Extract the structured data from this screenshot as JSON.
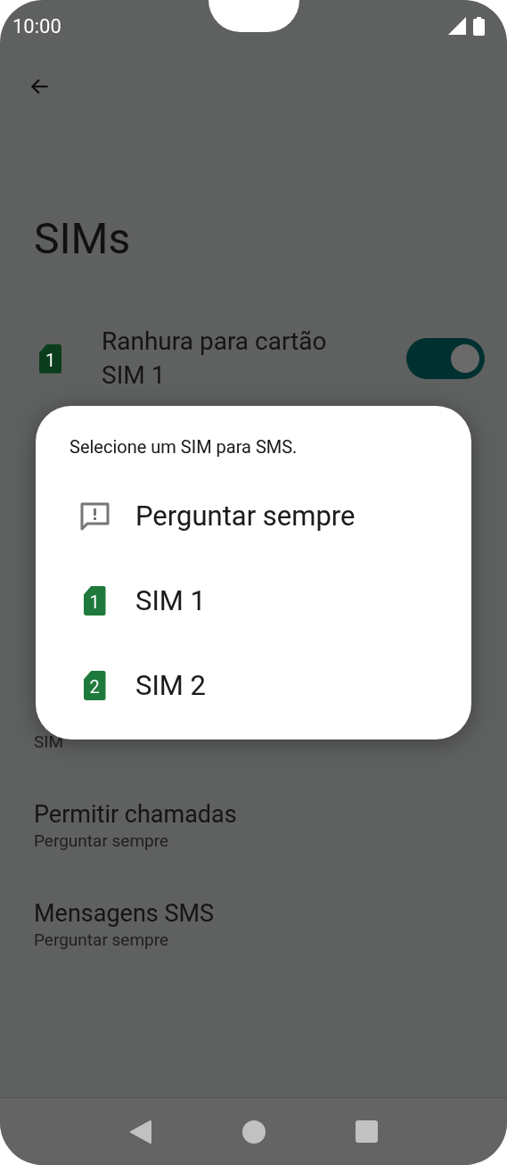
{
  "status_bar": {
    "time": "10:00"
  },
  "title": "SIMs",
  "sim_slot": {
    "label": "Ranhura para cartão SIM 1",
    "badge": "1",
    "on": true
  },
  "hidden_row_subtitle": "SIM",
  "settings": [
    {
      "title": "Permitir chamadas",
      "subtitle": "Perguntar sempre"
    },
    {
      "title": "Mensagens SMS",
      "subtitle": "Perguntar sempre"
    }
  ],
  "dialog": {
    "title": "Selecione um SIM para SMS.",
    "options": [
      {
        "kind": "ask",
        "label": "Perguntar sempre"
      },
      {
        "kind": "sim",
        "badge": "1",
        "label": "SIM 1"
      },
      {
        "kind": "sim",
        "badge": "2",
        "label": "SIM 2"
      }
    ]
  }
}
